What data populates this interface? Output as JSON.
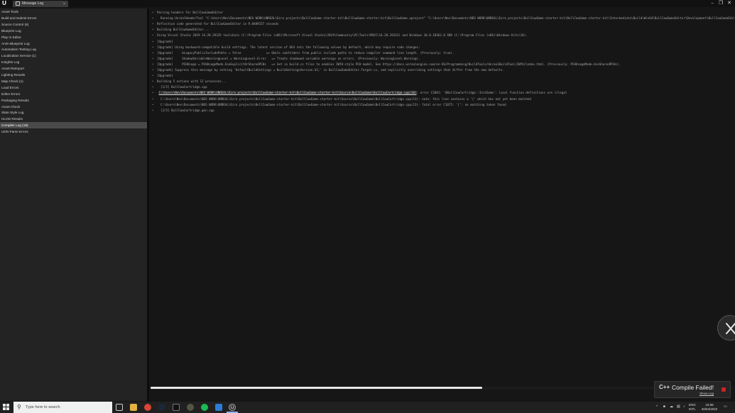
{
  "window": {
    "tab_title": "Message Log",
    "logo": "U",
    "controls": [
      "minimize-icon",
      "restore-icon",
      "close-icon"
    ]
  },
  "sidebar": {
    "items": [
      {
        "label": "Asset Tools"
      },
      {
        "label": "Build and Submit Errors"
      },
      {
        "label": "Source Control (6)"
      },
      {
        "label": "Blueprint Log"
      },
      {
        "label": "Play In Editor"
      },
      {
        "label": "Anim Blueprint Log"
      },
      {
        "label": "Automation Testing Log"
      },
      {
        "label": "Localization Service (1)"
      },
      {
        "label": "Insights Log"
      },
      {
        "label": "Asset Reimport"
      },
      {
        "label": "Lighting Results"
      },
      {
        "label": "Map Check (1)"
      },
      {
        "label": "Load Errors"
      },
      {
        "label": "Editor Errors"
      },
      {
        "label": "Packaging Results"
      },
      {
        "label": "Asset Check"
      },
      {
        "label": "Slate Style Log"
      },
      {
        "label": "HLOD Results"
      },
      {
        "label": "Compiler Log (18)",
        "selected": true
      },
      {
        "label": "UDN Parse Errors"
      }
    ]
  },
  "log": {
    "lines": [
      {
        "text": "Parsing headers for BullCowGameEditor"
      },
      {
        "text": "  Running UnrealHeaderTool \"C:\\Users\\Nev\\Documents\\NEO WORK\\UNREAL\\Ezra projects\\BullCowGame-starter-kit\\BullCowGame-starter-kit\\BullCowGame.uproject\" \"C:\\Users\\Nev\\Documents\\NEO WORK\\UNREAL\\Ezra projects\\BullCowGame-starter-kit\\BullCowGame-starter-kit\\Intermediate\\Build\\Win64\\BullCowGameEditor\\Development\\BullCowGameEditor.uhtmanifest\""
      },
      {
        "text": "Reflection code generated for BullCowGameEditor in 9.0409157 seconds"
      },
      {
        "text": "Building BullCowGameEditor..."
      },
      {
        "text": "Using Visual Studio 2019 14.28.29335 toolchain (C:\\Program Files (x86)\\Microsoft Visual Studio\\2019\\Community\\VC\\Tools\\MSVC\\14.28.29333) and Windows 10.0.18362.0 SDK (C:\\Program Files (x86)\\Windows Kits\\10)."
      },
      {
        "text": "[Upgrade]"
      },
      {
        "text": "[Upgrade] Using backward-compatible build settings. The latest version of UE4 sets the following values by default, which may require code changes:"
      },
      {
        "text": "[Upgrade]     bLegacyPublicIncludePaths = false              => Omits subfolders from public include paths to reduce compiler command line length. (Previously: true)."
      },
      {
        "text": "[Upgrade]     ShadowVariableWarningLevel = WarningLevel.Error   => Treats shadowed variable warnings as errors. (Previously: WarningLevel.Warning)."
      },
      {
        "text": "[Upgrade]     PCHUsage = PCHUsageMode.UseExplicitOrSharedPCHs   => Set in build.cs files to enables IWYU-style PCH model. See https://docs.unrealengine.com/en-US/Programming/BuildTools/UnrealBuildTool/IWYU/index.html. (Previously: PCHUsageMode.UseSharedPCHs)."
      },
      {
        "text": "[Upgrade] Suppress this message by setting 'DefaultBuildSettings = BuildSettingsVersion.V2;' in BullCowGameEditor.Target.cs, and explicitly overriding settings that differ from the new defaults."
      },
      {
        "text": "[Upgrade]"
      },
      {
        "text": "Building 5 actions with 12 processes..."
      },
      {
        "text": "  [1/5] BullCowCartridge.cpp"
      },
      {
        "link": "C:\\Users\\Nev\\Documents\\NEO WORK\\UNREAL\\Ezra projects\\BullCowGame-starter-kit\\BullCowGame-starter-kit\\Source\\BullCowGame\\BullCowCartridge.cpp(38)",
        "text": ": error C2601: 'UBullCowCartridge::InitGame': local function definitions are illegal"
      },
      {
        "text": "  C:\\Users\\Nev\\Documents\\NEO WORK\\UNREAL\\Ezra projects\\BullCowGame-starter-kit\\BullCowGame-starter-kit\\Source\\BullCowGame\\BullCowCartridge.cpp(13): note: this line contains a '{' which has not yet been matched"
      },
      {
        "text": "  C:\\Users\\Nev\\Documents\\NEO WORK\\UNREAL\\Ezra projects\\BullCowGame-starter-kit\\BullCowGame-starter-kit\\Source\\BullCowGame\\BullCowCartridge.cpp(13): fatal error C1075: '{': no matching token found"
      },
      {
        "text": "  [2/5] BullCowCartridge.gen.cpp"
      }
    ]
  },
  "scroll": {
    "horizontal_position_fraction": 0.0,
    "visible_fraction": 0.57
  },
  "notification": {
    "icon": "C++",
    "title": "Compile Failed!",
    "link": "Show Log"
  },
  "taskbar": {
    "search_placeholder": "Type here to search",
    "apps": [
      "task-view-icon",
      "file-explorer-icon",
      "chrome-icon",
      "steam-icon",
      "terminal-icon",
      "obs-icon",
      "spotify-icon",
      "vscode-icon",
      "unreal-icon"
    ],
    "tray_lang_1": "ENG",
    "tray_lang_2": "INTL",
    "time": "15:58",
    "date": "20/04/2022"
  }
}
